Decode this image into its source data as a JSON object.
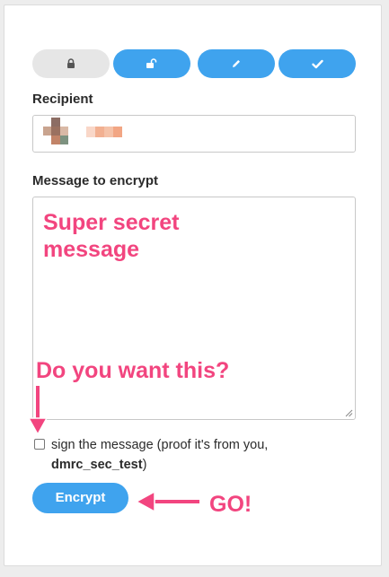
{
  "modes": [
    {
      "icon": "lock-icon",
      "active": false
    },
    {
      "icon": "unlock-icon",
      "active": true
    },
    {
      "icon": "pencil-icon",
      "active": true
    },
    {
      "icon": "checkmark-icon",
      "active": true
    }
  ],
  "recipient": {
    "label": "Recipient",
    "value": ""
  },
  "message": {
    "label": "Message to encrypt",
    "value": ""
  },
  "sign": {
    "prefix": "sign the message (proof it's from you,",
    "username": "dmrc_sec_test",
    "suffix": ")",
    "checked": false
  },
  "encrypt_button": {
    "label": "Encrypt"
  },
  "annotations": {
    "message_overlay": "Super secret\nmessage",
    "sign_callout": "Do you want this?",
    "go_callout": "GO!"
  },
  "colors": {
    "accent": "#3fa3ee",
    "annotation": "#f2457f"
  }
}
